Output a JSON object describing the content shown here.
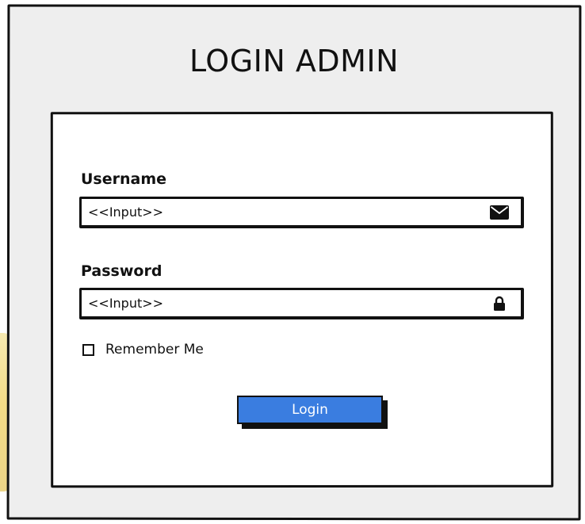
{
  "page": {
    "title": "LOGIN ADMIN"
  },
  "form": {
    "username": {
      "label": "Username",
      "value": "<<Input>>",
      "icon": "envelope-icon"
    },
    "password": {
      "label": "Password",
      "value": "<<Input>>",
      "icon": "lock-icon"
    },
    "remember": {
      "label": "Remember Me",
      "checked": false
    },
    "submit_label": "Login"
  },
  "colors": {
    "panel_background": "#eeeeee",
    "button_accent": "#3a7de0",
    "stroke": "#111111"
  }
}
